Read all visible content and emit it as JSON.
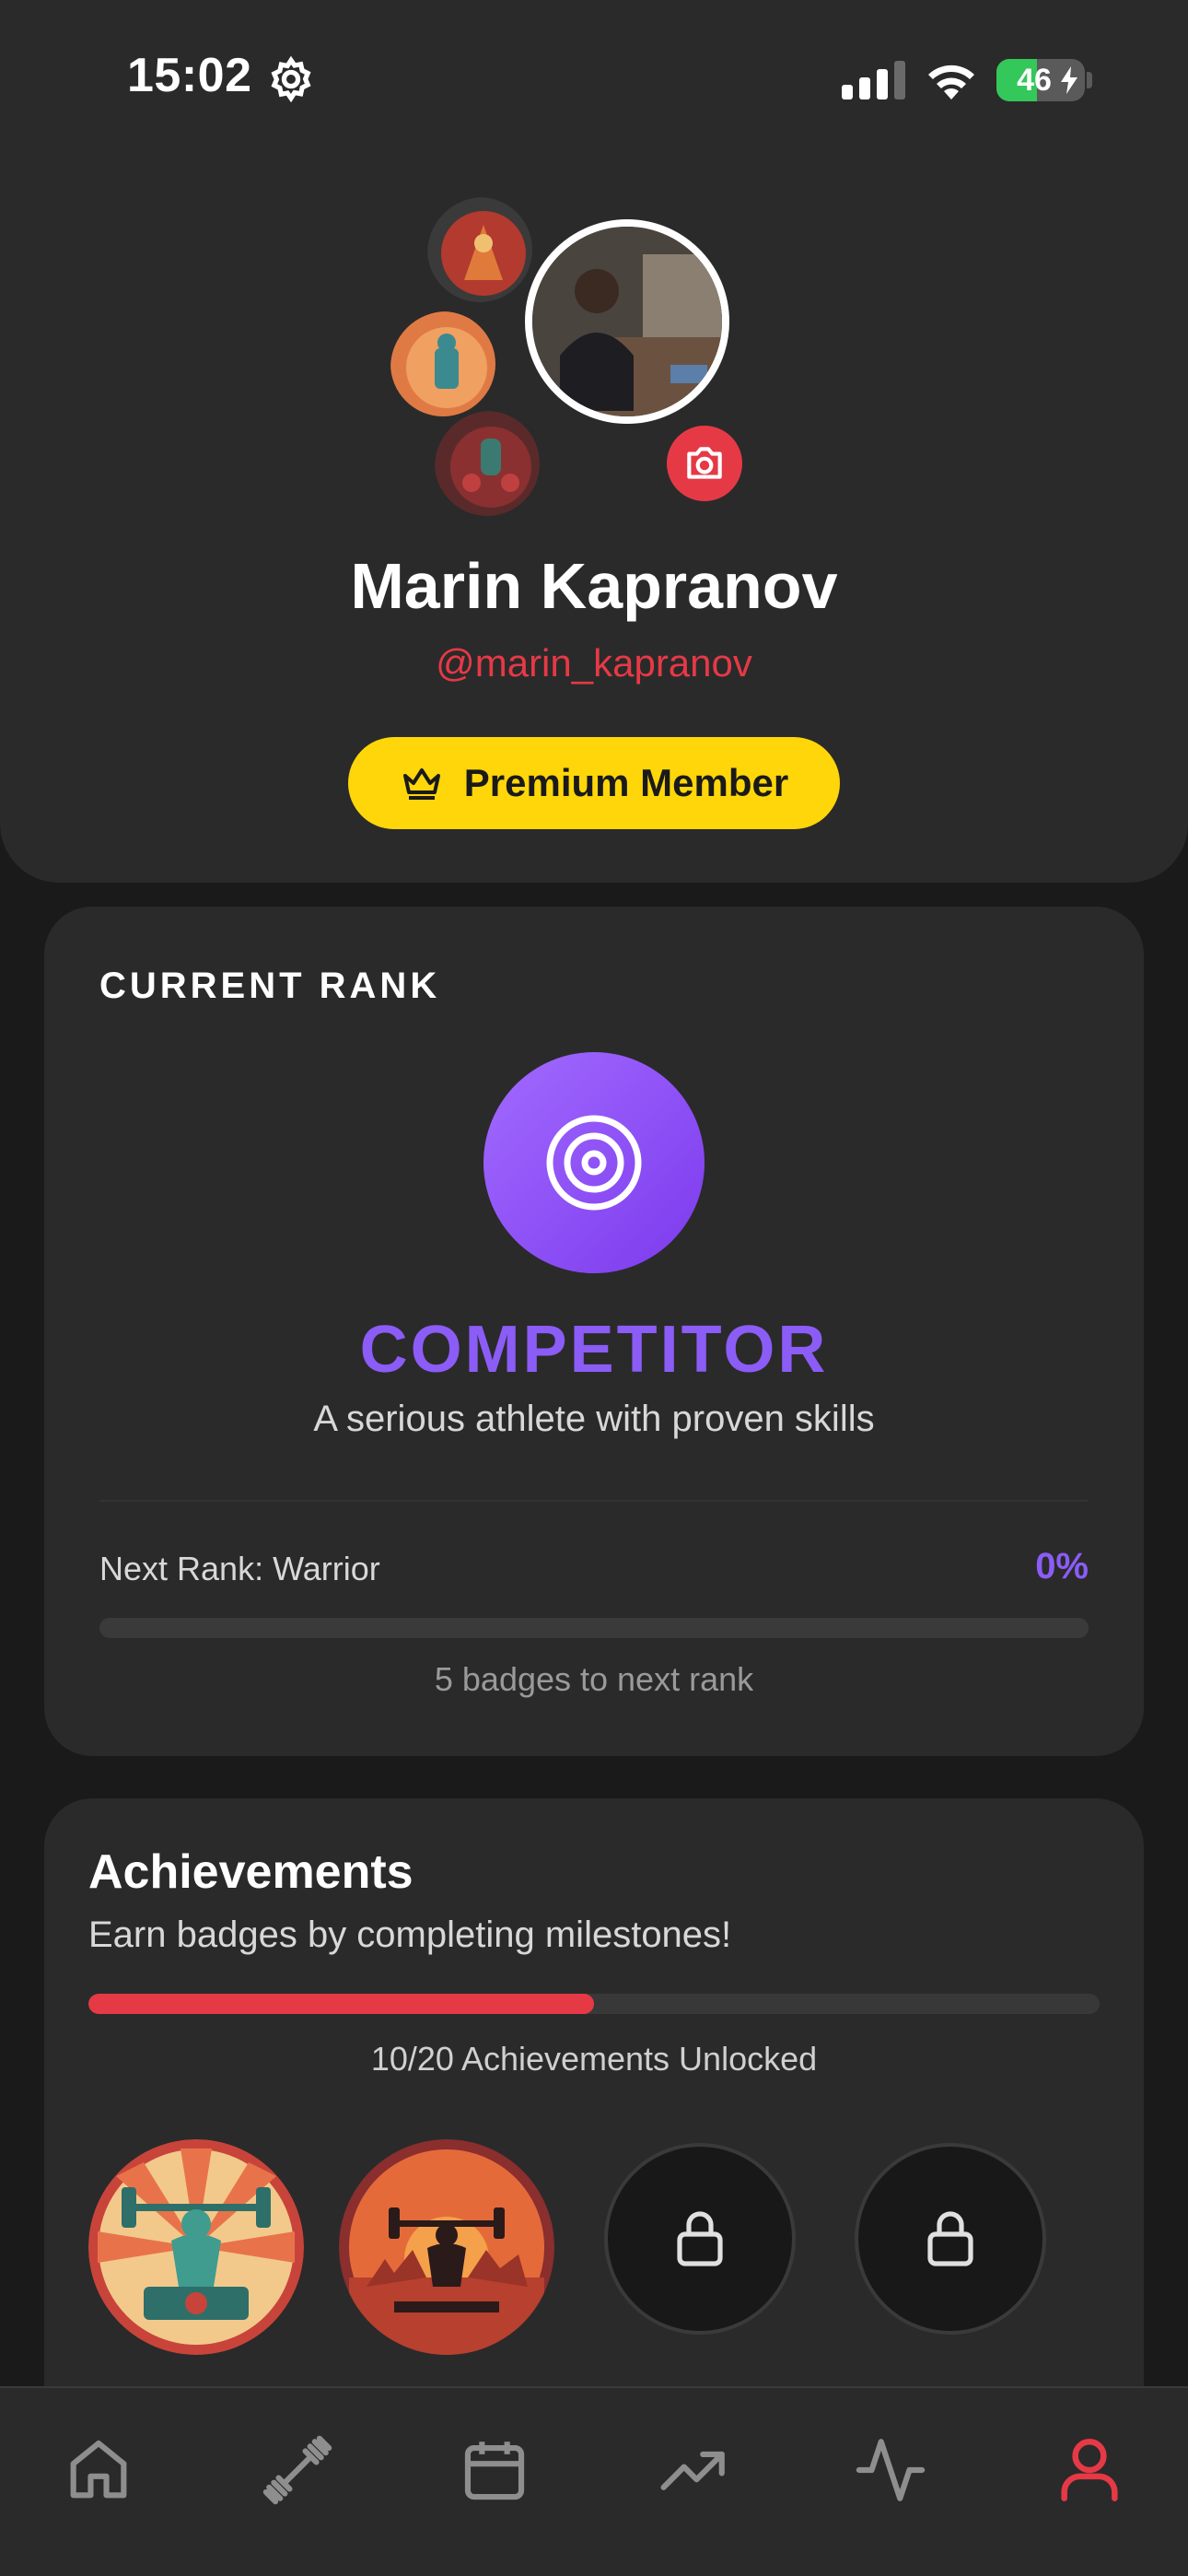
{
  "status_bar": {
    "time": "15:02",
    "battery_level": "46",
    "battery_fraction": 0.46,
    "icons": [
      "gear-icon",
      "signal-icon",
      "wifi-icon",
      "battery-charging-icon"
    ]
  },
  "profile": {
    "name": "Marin Kapranov",
    "handle": "@marin_kapranov",
    "membership_label": "Premium Member",
    "membership_icon": "crown-icon",
    "camera_icon": "camera-icon",
    "colors": {
      "accent": "#e63946",
      "premium": "#ffd60a"
    }
  },
  "rank": {
    "heading": "CURRENT RANK",
    "icon": "target-icon",
    "title": "COMPETITOR",
    "description": "A serious athlete with proven skills",
    "next_rank_label": "Next Rank: Warrior",
    "progress_percent_label": "0%",
    "progress_fraction": 0,
    "badges_to_next": "5 badges to next rank",
    "color": "#8b5cf6"
  },
  "achievements": {
    "title": "Achievements",
    "subtitle": "Earn badges by completing milestones!",
    "unlocked_label": "10/20 Achievements Unlocked",
    "progress_fraction": 0.5,
    "badges": [
      {
        "state": "unlocked",
        "icon": "weightlifter-badge-icon"
      },
      {
        "state": "unlocked",
        "icon": "barbell-sunset-badge-icon"
      },
      {
        "state": "locked",
        "icon": "lock-icon"
      },
      {
        "state": "locked",
        "icon": "lock-icon"
      }
    ]
  },
  "tab_bar": {
    "tabs": [
      {
        "name": "home",
        "icon": "home-icon",
        "active": false
      },
      {
        "name": "workouts",
        "icon": "dumbbell-icon",
        "active": false
      },
      {
        "name": "calendar",
        "icon": "calendar-icon",
        "active": false
      },
      {
        "name": "progress",
        "icon": "trending-up-icon",
        "active": false
      },
      {
        "name": "activity",
        "icon": "activity-icon",
        "active": false
      },
      {
        "name": "profile",
        "icon": "user-icon",
        "active": true
      }
    ],
    "active_color": "#e63946",
    "inactive_color": "#8e8e8e"
  }
}
